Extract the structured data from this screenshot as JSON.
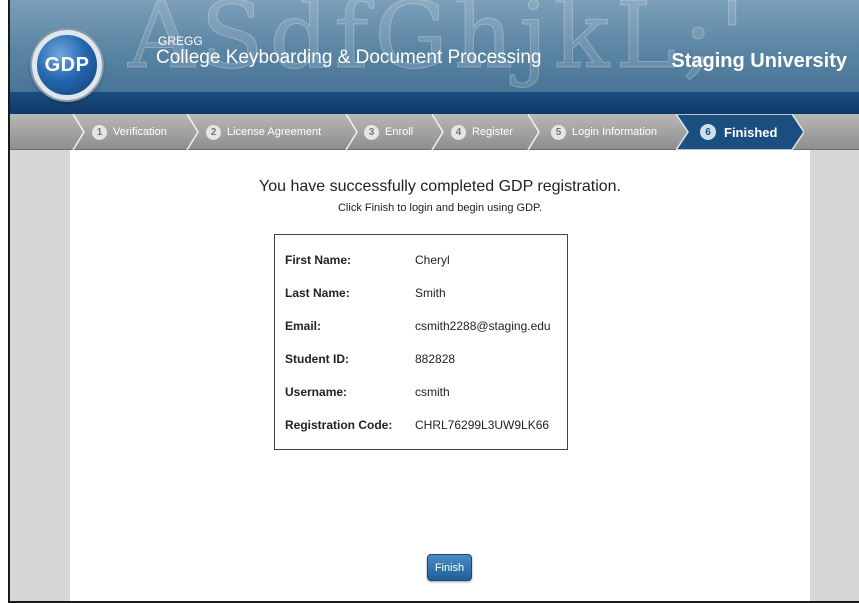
{
  "header": {
    "logo_text": "GDP",
    "brand_small": "GREGG",
    "brand_title": "College Keyboarding & Document Processing",
    "university": "Staging University",
    "watermark": "ASdfGhjkL;'"
  },
  "steps": [
    {
      "num": "1",
      "label": "Verification"
    },
    {
      "num": "2",
      "label": "License Agreement"
    },
    {
      "num": "3",
      "label": "Enroll"
    },
    {
      "num": "4",
      "label": "Register"
    },
    {
      "num": "5",
      "label": "Login Information"
    },
    {
      "num": "6",
      "label": "Finished",
      "active": true
    }
  ],
  "content": {
    "headline": "You have successfully completed GDP registration.",
    "subline": "Click Finish to login and begin using GDP."
  },
  "info": [
    {
      "key": "First Name:",
      "value": "Cheryl"
    },
    {
      "key": "Last Name:",
      "value": "Smith"
    },
    {
      "key": "Email:",
      "value": "csmith2288@staging.edu"
    },
    {
      "key": "Student ID:",
      "value": "882828"
    },
    {
      "key": "Username:",
      "value": "csmith"
    },
    {
      "key": "Registration Code:",
      "value": "CHRL76299L3UW9LK66"
    }
  ],
  "finish_label": "Finish",
  "colors": {
    "header_blue": "#5a84a3",
    "stripe_blue": "#0f3a66",
    "active_step": "#1b4f80",
    "button_blue": "#1f5f99"
  }
}
